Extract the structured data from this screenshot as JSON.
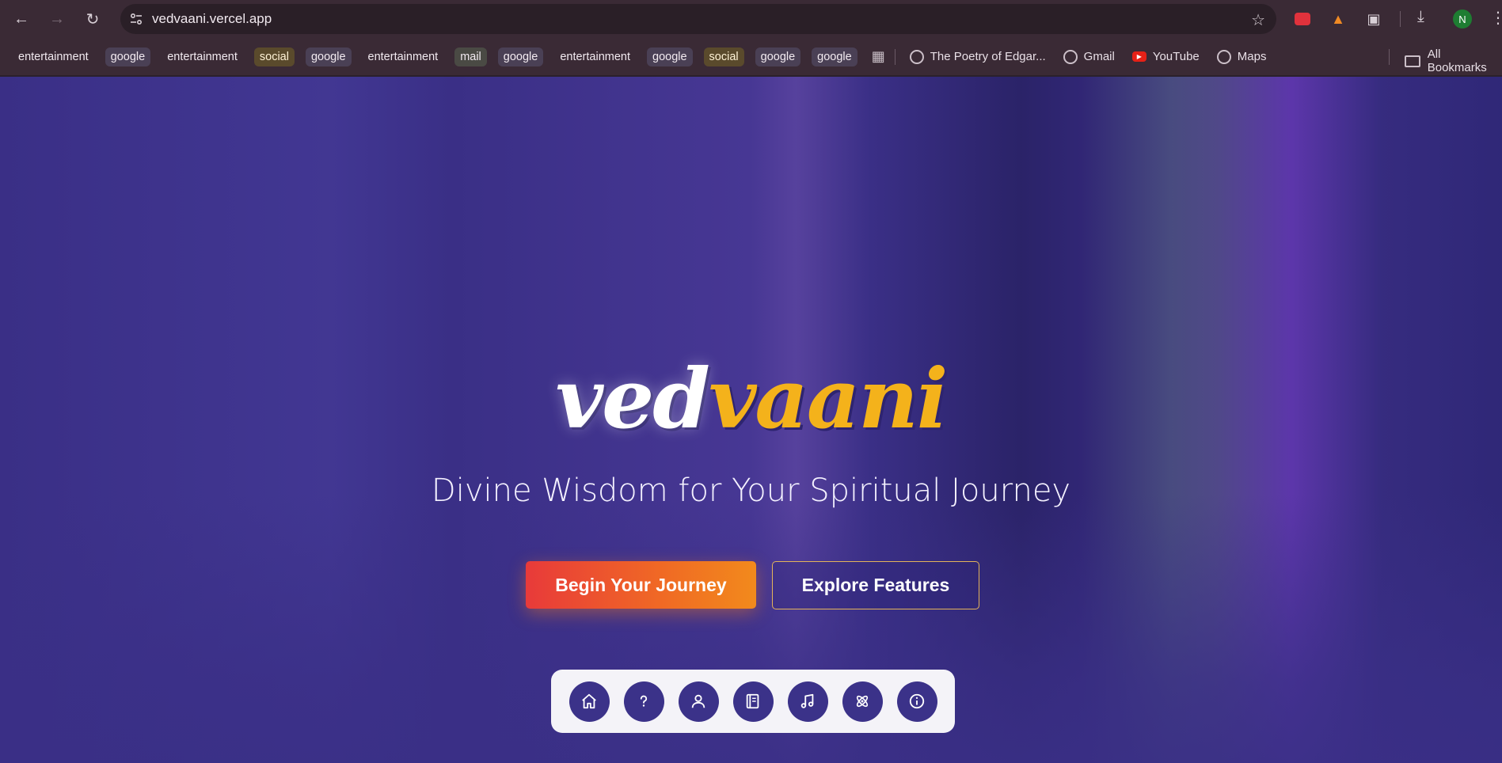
{
  "browser": {
    "url": "vedvaani.vercel.app",
    "profile_initial": "N",
    "bookmark_chips": [
      {
        "label": "entertainment",
        "style": "plain"
      },
      {
        "label": "google",
        "style": "tinted"
      },
      {
        "label": "entertainment",
        "style": "plain"
      },
      {
        "label": "social",
        "style": "social"
      },
      {
        "label": "google",
        "style": "tinted"
      },
      {
        "label": "entertainment",
        "style": "plain"
      },
      {
        "label": "mail",
        "style": "mail"
      },
      {
        "label": "google",
        "style": "tinted"
      },
      {
        "label": "entertainment",
        "style": "plain"
      },
      {
        "label": "google",
        "style": "tinted"
      },
      {
        "label": "social",
        "style": "social"
      },
      {
        "label": "google",
        "style": "tinted"
      },
      {
        "label": "google",
        "style": "tinted"
      }
    ],
    "bookmark_links": [
      {
        "label": "The Poetry of Edgar...",
        "icon": "globe-icon"
      },
      {
        "label": "Gmail",
        "icon": "globe-icon"
      },
      {
        "label": "YouTube",
        "icon": "youtube-icon"
      },
      {
        "label": "Maps",
        "icon": "globe-icon"
      }
    ],
    "all_bookmarks_label": "All Bookmarks"
  },
  "hero": {
    "logo_part1": "ved",
    "logo_part2": "vaani",
    "tagline": "Divine Wisdom for Your Spiritual Journey",
    "primary_cta": "Begin Your Journey",
    "secondary_cta": "Explore Features"
  },
  "dock": {
    "items": [
      {
        "name": "home-icon"
      },
      {
        "name": "help-icon"
      },
      {
        "name": "user-icon"
      },
      {
        "name": "book-icon"
      },
      {
        "name": "music-icon"
      },
      {
        "name": "atom-icon"
      },
      {
        "name": "info-icon"
      }
    ]
  },
  "colors": {
    "background": "#3a2f86",
    "accent_gold": "#f4b21b",
    "cta_start": "#e83a3a",
    "cta_end": "#f28a1c",
    "dock_bg": "#f4f3f8",
    "dock_button": "#3b3289"
  }
}
